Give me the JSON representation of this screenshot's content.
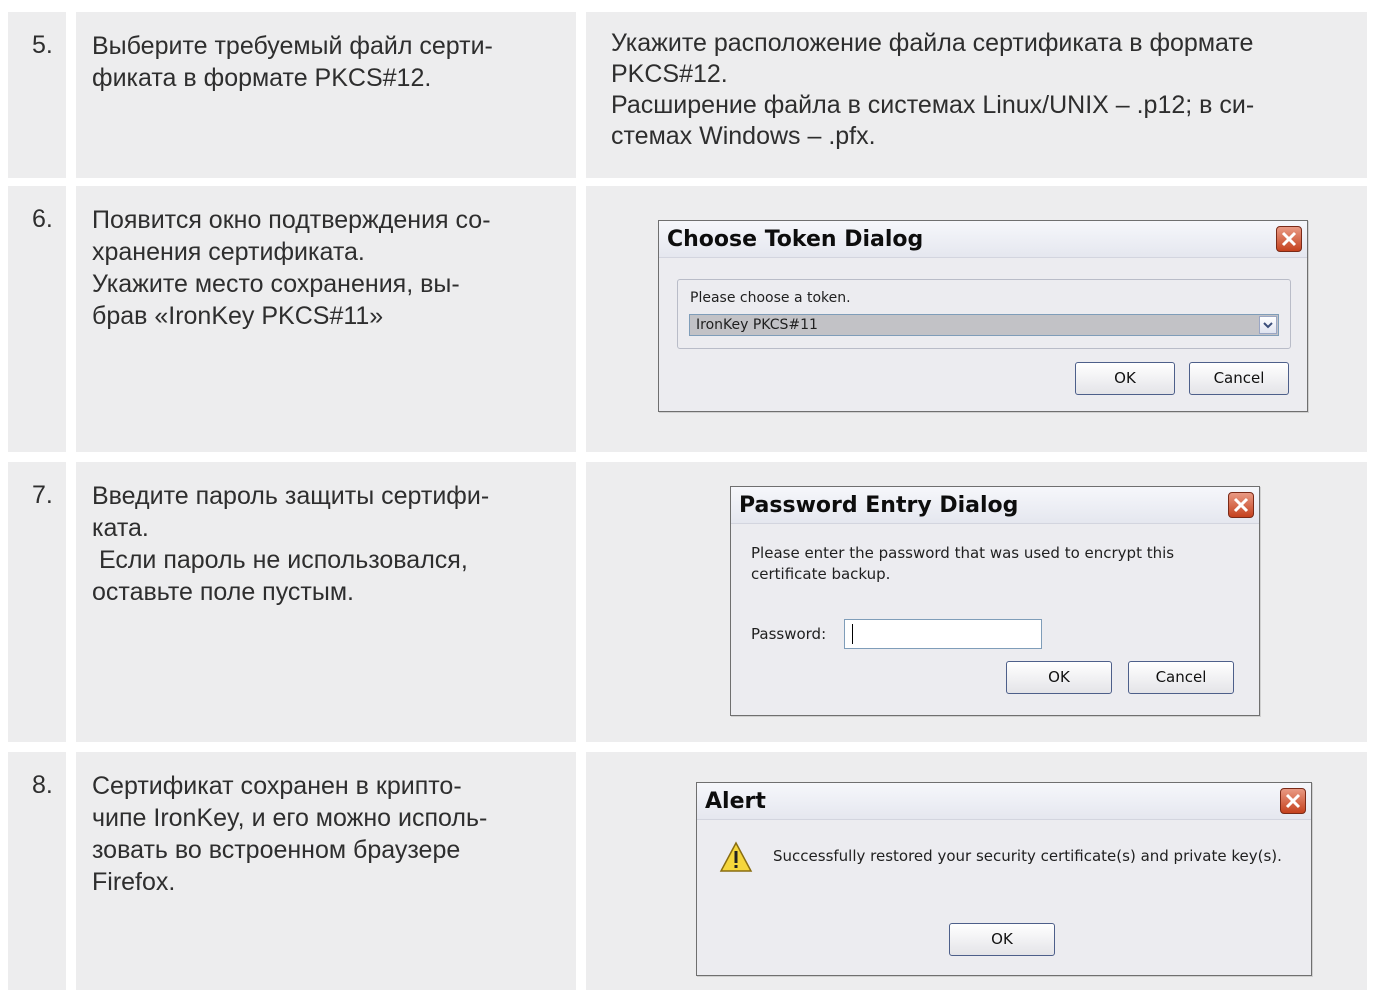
{
  "rows": [
    {
      "number": "5.",
      "step_lines": [
        "Выберите требуемый файл серти-",
        "фиката в формате PKCS#12."
      ],
      "desc_lines": [
        "Укажите расположение файла сертификата в формате",
        "PKCS#12.",
        "Расширение файла в системах Linux/UNIX – .p12; в си-",
        "стемах Windows – .pfx."
      ]
    },
    {
      "number": "6.",
      "step_lines": [
        "Появится окно подтверждения со-",
        "хранения сертификата.",
        "Укажите место сохранения, вы-",
        "брав «IronKey PKCS#11»"
      ]
    },
    {
      "number": "7.",
      "step_lines": [
        "Введите пароль защиты сертифи-",
        "ката.",
        " Если пароль не использовался,",
        "оставьте поле пустым."
      ]
    },
    {
      "number": "8.",
      "step_lines": [
        "Сертификат сохранен в крипто-",
        "чипе IronKey, и его можно исполь-",
        "зовать во встроенном браузере",
        "Firefox."
      ]
    }
  ],
  "token_dialog": {
    "title": "Choose Token Dialog",
    "prompt": "Please choose a token.",
    "selected": "IronKey PKCS#11",
    "ok": "OK",
    "cancel": "Cancel"
  },
  "password_dialog": {
    "title": "Password Entry Dialog",
    "message_line1": "Please enter the password that was used to encrypt this",
    "message_line2": "certificate backup.",
    "label": "Password:",
    "value": "",
    "ok": "OK",
    "cancel": "Cancel"
  },
  "alert_dialog": {
    "title": "Alert",
    "message": "Successfully restored your security certificate(s) and private key(s).",
    "ok": "OK"
  }
}
